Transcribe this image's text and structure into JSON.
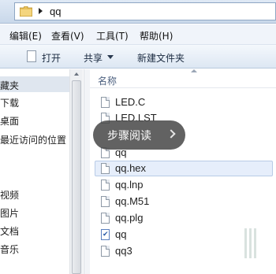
{
  "address_bar": {
    "icon": "folder-icon",
    "path": "qq"
  },
  "menu": [
    "编辑(E)",
    "查看(V)",
    "工具(T)",
    "帮助(H)"
  ],
  "toolbar": {
    "open_label": "打开",
    "share_label": "共享",
    "new_folder_label": "新建文件夹"
  },
  "nav": {
    "items": [
      "藏夹",
      "下载",
      "桌面",
      "最近访问的位置",
      "视频",
      "图片",
      "文档",
      "音乐"
    ],
    "selected": "藏夹"
  },
  "content": {
    "column_name": "名称",
    "files": [
      {
        "name": "LED.C",
        "icon": "document-icon"
      },
      {
        "name": "LED.LST",
        "icon": "document-icon"
      },
      {
        "name": "qq",
        "icon": "document-icon"
      },
      {
        "name": "qq.hex",
        "icon": "document-icon",
        "selected": true
      },
      {
        "name": "qq.lnp",
        "icon": "document-icon"
      },
      {
        "name": "qq.M51",
        "icon": "document-icon"
      },
      {
        "name": "qq.plg",
        "icon": "document-icon"
      },
      {
        "name": "qq",
        "icon": "application-icon"
      },
      {
        "name": "qq3",
        "icon": "document-icon"
      }
    ]
  },
  "overlay": {
    "label": "步骤阅读",
    "icon": "chevron-right-icon"
  },
  "colors": {
    "selection": "#e6eefb",
    "toolbar_gradient_top": "#f4f8fc",
    "overlay_bg": "#484848"
  }
}
